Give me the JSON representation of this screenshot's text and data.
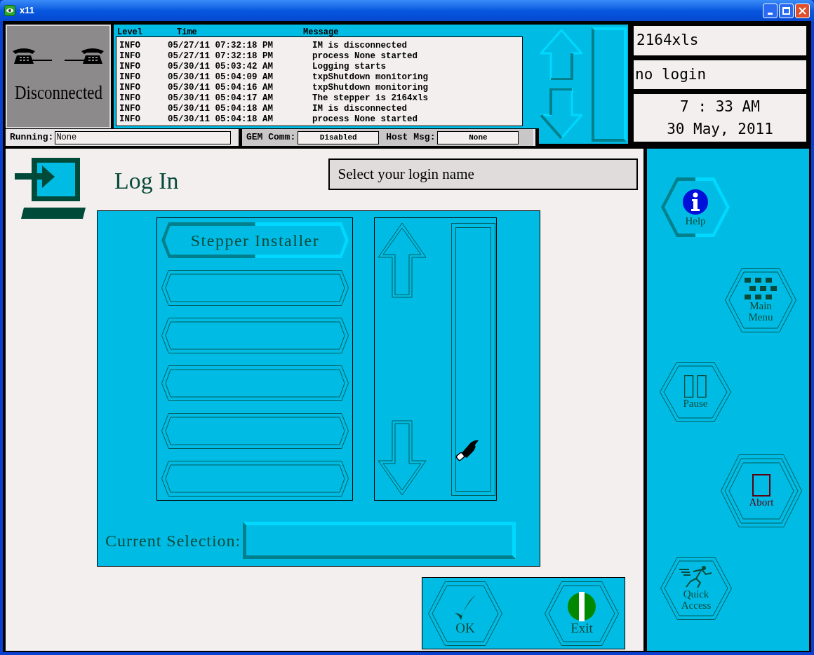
{
  "window": {
    "title": "x11"
  },
  "connection": {
    "status": "Disconnected"
  },
  "log": {
    "columns": [
      "Level",
      "Time",
      "Message"
    ],
    "rows": [
      {
        "level": "INFO",
        "time": "05/27/11 07:32:18 PM",
        "message": "IM is disconnected"
      },
      {
        "level": "INFO",
        "time": "05/27/11 07:32:18 PM",
        "message": "process None started"
      },
      {
        "level": "INFO",
        "time": "05/30/11 05:03:42 AM",
        "message": "Logging starts"
      },
      {
        "level": "INFO",
        "time": "05/30/11 05:04:09 AM",
        "message": "txpShutdown monitoring"
      },
      {
        "level": "INFO",
        "time": "05/30/11 05:04:16 AM",
        "message": "txpShutdown monitoring"
      },
      {
        "level": "INFO",
        "time": "05/30/11 05:04:17 AM",
        "message": "The stepper is 2164xls"
      },
      {
        "level": "INFO",
        "time": "05/30/11 05:04:18 AM",
        "message": "IM is disconnected"
      },
      {
        "level": "INFO",
        "time": "05/30/11 05:04:18 AM",
        "message": "process None started"
      }
    ]
  },
  "status_bar": {
    "running_label": "Running:",
    "running_value": "None",
    "gem_label": "GEM Comm:",
    "gem_value": "Disabled",
    "host_label": "Host Msg:",
    "host_value": "None"
  },
  "info": {
    "machine": "2164xls",
    "user": "no login",
    "time": "7 : 33 AM",
    "date": "30 May, 2011"
  },
  "login": {
    "title": "Log In",
    "prompt": "Select your login name",
    "names": [
      {
        "label": "Stepper Installer"
      }
    ],
    "current_selection_label": "Current Selection:"
  },
  "sidebar": [
    {
      "label": "Help",
      "kind": "help",
      "highlighted": true
    },
    {
      "label": "Main Menu",
      "kind": "menu",
      "highlighted": false
    },
    {
      "label": "Pause",
      "kind": "pause",
      "highlighted": false
    },
    {
      "label": "Abort",
      "kind": "abort",
      "highlighted": false
    },
    {
      "label": "Quick Access",
      "kind": "quick",
      "highlighted": false
    }
  ],
  "actions": [
    {
      "label": "OK",
      "kind": "ok"
    },
    {
      "label": "Exit",
      "kind": "exit"
    }
  ]
}
